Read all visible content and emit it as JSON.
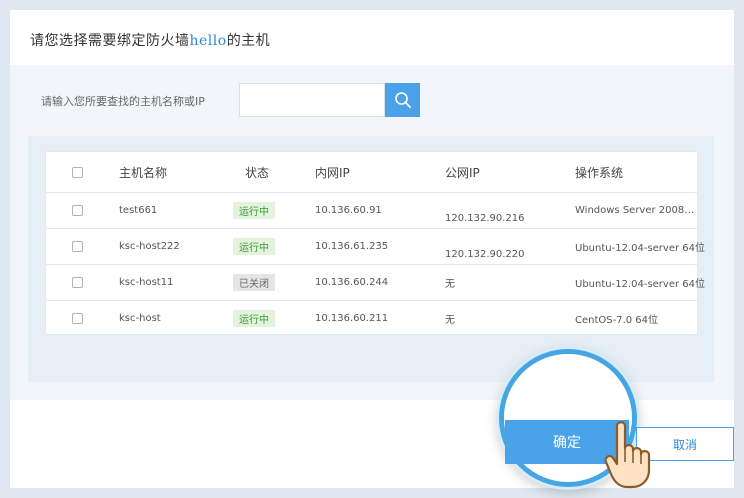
{
  "dialog": {
    "title_prefix": "请您选择需要绑定防火墙",
    "title_highlight": "hello",
    "title_suffix": "的主机"
  },
  "search": {
    "label": "请输入您所要查找的主机名称或IP",
    "value": "",
    "placeholder": "",
    "button_icon": "search-icon"
  },
  "table": {
    "headers": [
      "主机名称",
      "状态",
      "内网IP",
      "公网IP",
      "操作系统"
    ],
    "rows": [
      {
        "name": "test661",
        "status": "运行中",
        "status_type": "run",
        "private_ip": "10.136.60.91",
        "public_ip": "120.132.90.216",
        "os": "Windows Server 2008…"
      },
      {
        "name": "ksc-host222",
        "status": "运行中",
        "status_type": "run",
        "private_ip": "10.136.61.235",
        "public_ip": "120.132.90.220",
        "os": "Ubuntu-12.04-server 64位"
      },
      {
        "name": "ksc-host11",
        "status": "已关闭",
        "status_type": "off",
        "private_ip": "10.136.60.244",
        "public_ip": "无",
        "os": "Ubuntu-12.04-server 64位"
      },
      {
        "name": "ksc-host",
        "status": "运行中",
        "status_type": "run",
        "private_ip": "10.136.60.211",
        "public_ip": "无",
        "os": "CentOS-7.0 64位"
      }
    ]
  },
  "actions": {
    "confirm_label": "确定",
    "cancel_label": "取消"
  },
  "colors": {
    "accent": "#4aa3e8",
    "running": "#3a9a35",
    "closed": "#666666"
  }
}
